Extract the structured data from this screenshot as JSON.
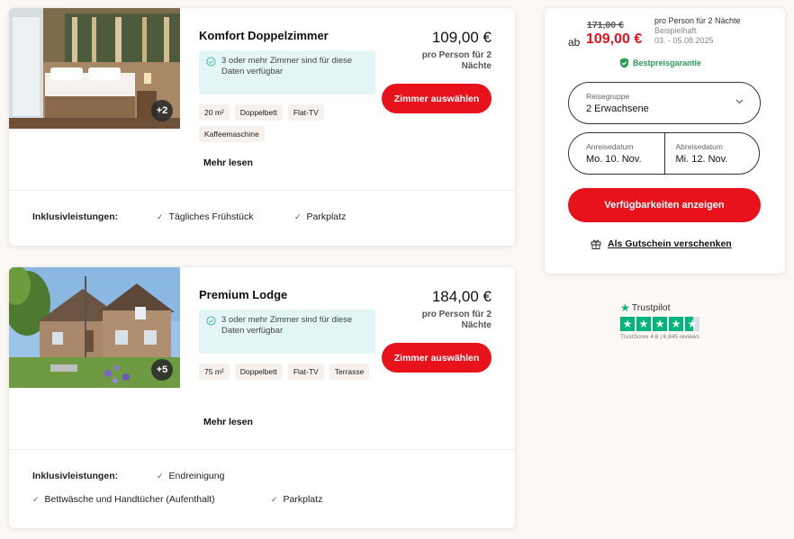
{
  "rooms": [
    {
      "title": "Komfort Doppelzimmer",
      "more_photos": "+2",
      "availability": "3 oder mehr Zimmer sind für diese Daten verfügbar",
      "tags": [
        "20 m²",
        "Doppelbett",
        "Flat-TV",
        "Kaffeemaschine"
      ],
      "more_label": "Mehr lesen",
      "price": "109,00 €",
      "price_note": "pro Person für 2 Nächte",
      "select_label": "Zimmer auswählen",
      "inclusions_label": "Inklusivleistungen:",
      "inclusions": [
        "Tägliches Frühstück",
        "Parkplatz"
      ]
    },
    {
      "title": "Premium Lodge",
      "more_photos": "+5",
      "availability": "3 oder mehr Zimmer sind für diese Daten verfügbar",
      "tags": [
        "75 m²",
        "Doppelbett",
        "Flat-TV",
        "Terrasse"
      ],
      "more_label": "Mehr lesen",
      "price": "184,00 €",
      "price_note": "pro Person für 2 Nächte",
      "select_label": "Zimmer auswählen",
      "inclusions_label": "Inklusivleistungen:",
      "inclusions": [
        "Endreinigung",
        "Bettwäsche und Handtücher (Aufenthalt)",
        "Parkplatz"
      ]
    }
  ],
  "booking": {
    "old_price": "171,00 €",
    "from_label": "ab",
    "new_price": "109,00 €",
    "note_line1": "pro Person für 2 Nächte",
    "note_line2": "Beispielhaft",
    "note_line3": "03. - 05.08.2025",
    "guarantee": "Bestpreisgarantie",
    "group_label": "Reisegruppe",
    "group_value": "2 Erwachsene",
    "arrival_label": "Anreisedatum",
    "arrival_value": "Mo. 10. Nov.",
    "departure_label": "Abreisedatum",
    "departure_value": "Mi. 12. Nov.",
    "availability_button": "Verfügbarkeiten anzeigen",
    "voucher_link": "Als Gutschein verschenken"
  },
  "trustpilot": {
    "title": "Trustpilot",
    "rating_stars": 4.5,
    "score_text": "TrustScore 4.6 | 6,845 reviews"
  },
  "colors": {
    "accent": "#e8121c",
    "success": "#2a9d57",
    "availability_bg": "#e3f5f4",
    "trustpilot": "#00b67a"
  }
}
